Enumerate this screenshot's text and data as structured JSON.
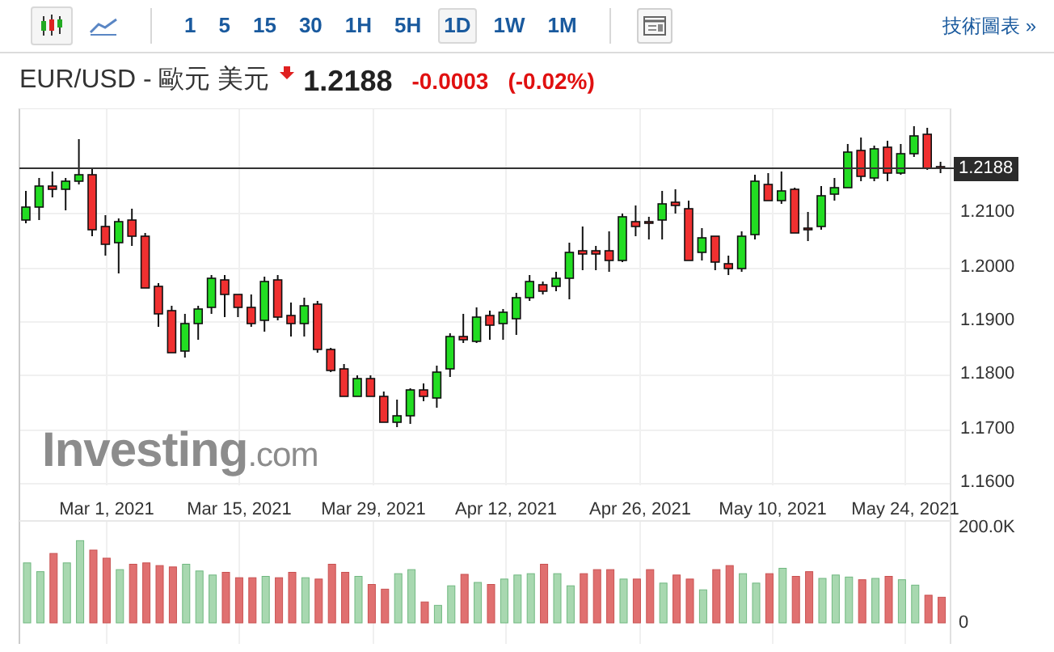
{
  "toolbar": {
    "chart_types": [
      {
        "kind": "candlestick",
        "selected": true
      },
      {
        "kind": "line",
        "selected": false
      }
    ],
    "intervals": [
      {
        "label": "1",
        "selected": false
      },
      {
        "label": "5",
        "selected": false
      },
      {
        "label": "15",
        "selected": false
      },
      {
        "label": "30",
        "selected": false
      },
      {
        "label": "1H",
        "selected": false
      },
      {
        "label": "5H",
        "selected": false
      },
      {
        "label": "1D",
        "selected": true
      },
      {
        "label": "1W",
        "selected": false
      },
      {
        "label": "1M",
        "selected": false
      }
    ],
    "link": "技術圖表 »"
  },
  "quote": {
    "title": "EUR/USD - 歐元 美元",
    "falling": true,
    "price": "1.2188",
    "change": "-0.0003",
    "change_percent": "(-0.02%)"
  },
  "chart": {
    "logo": "**Investing**.com",
    "current_price": "1.2188",
    "price_axis": [
      "1.2100",
      "1.2000",
      "1.1900",
      "1.1800",
      "1.1700",
      "1.1600"
    ],
    "date_axis": [
      "Mar 1, 2021",
      "Mar 15, 2021",
      "Mar 29, 2021",
      "Apr 12, 2021",
      "Apr 26, 2021",
      "May 10, 2021",
      "May 24, 2021"
    ],
    "volume_axis": [
      "200.0K",
      "0"
    ]
  }
}
